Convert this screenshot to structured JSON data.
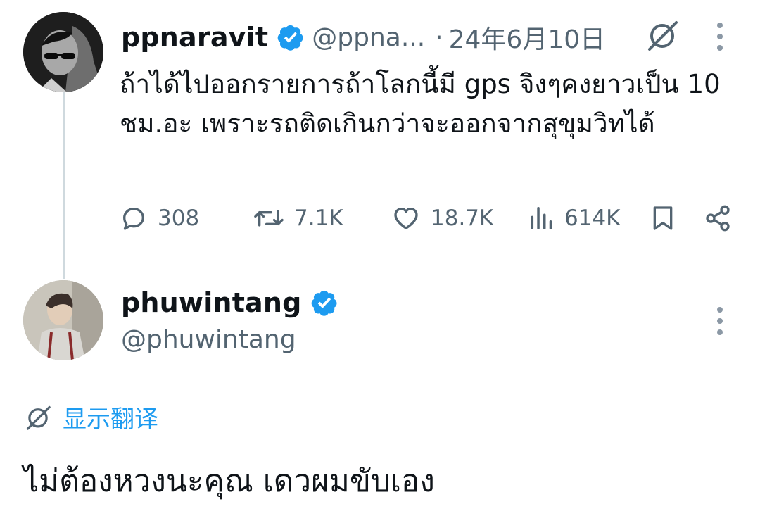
{
  "tweet": {
    "author_name": "ppnaravit",
    "author_handle": "@ppna...",
    "separator": "·",
    "date": "24年6月10日",
    "text": "ถ้าได้ไปออกรายการถ้าโลกนี้มี gps จิงๆคงยาวเป็น 10 ชม.อะ เพราะรถติดเกินกว่าจะออกจากสุขุมวิทได้",
    "stats": {
      "replies": "308",
      "retweets": "7.1K",
      "likes": "18.7K",
      "views": "614K"
    }
  },
  "reply": {
    "author_name": "phuwintang",
    "author_handle": "@phuwintang",
    "translate_label": "显示翻译",
    "text": "ไม่ต้องหวงนะคุณ เดวผมขับเอง"
  },
  "colors": {
    "verified": "#1d9bf0",
    "link": "#1d9bf0",
    "secondary_text": "#536471",
    "thread_line": "#cfd9de"
  },
  "icons": [
    "verified-badge-icon",
    "grok-icon",
    "more-icon",
    "reply-icon",
    "retweet-icon",
    "like-icon",
    "views-icon",
    "bookmark-icon",
    "share-icon",
    "translate-icon"
  ]
}
